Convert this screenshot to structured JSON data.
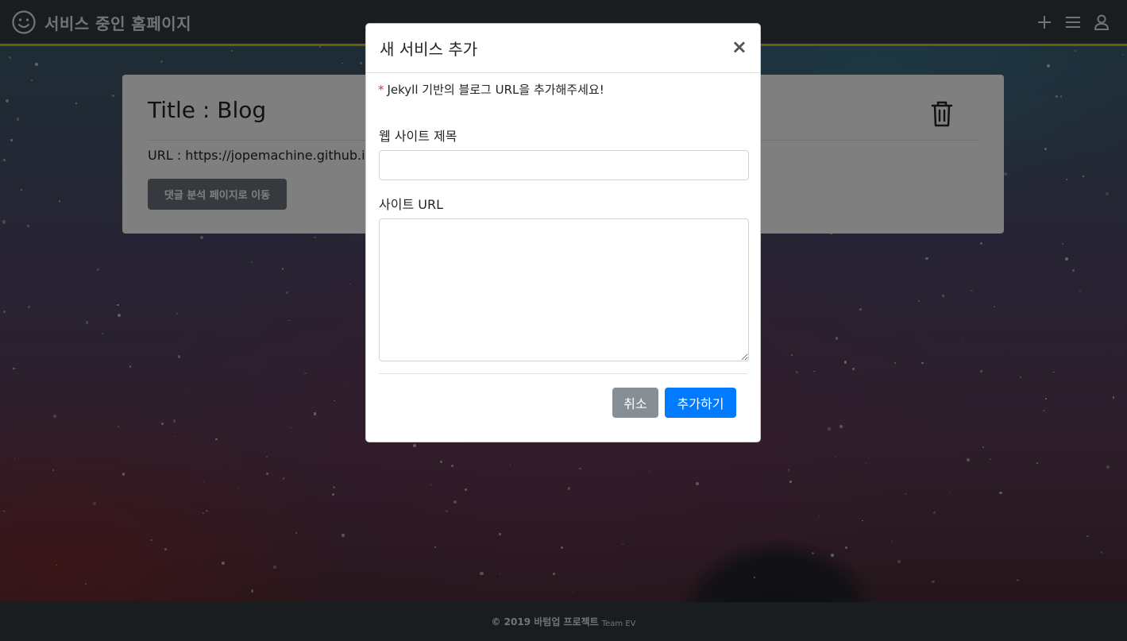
{
  "header": {
    "title": "서비스 중인 홈페이지",
    "icons": [
      "smiley-icon",
      "plus-icon",
      "menu-icon",
      "user-icon"
    ]
  },
  "card": {
    "title": "Title : Blog",
    "url": "URL : https://jopemachine.github.io",
    "button_label": "댓글 분석 페이지로 이동",
    "delete_icon": "trash-icon"
  },
  "modal": {
    "title": "새 서비스 추가",
    "close_label": "×",
    "notice_marker": "*",
    "notice": "Jekyll 기반의 블로그 URL을 추가해주세요!",
    "site_title_label": "웹 사이트 제목",
    "site_title_value": "",
    "site_url_label": "사이트 URL",
    "site_url_value": "",
    "cancel_label": "취소",
    "add_label": "추가하기"
  },
  "footer": {
    "text": "© 2019 바텀업 프로젝트",
    "team": "Team EV"
  },
  "colors": {
    "header_bg": "#343a40",
    "header_accent": "#c7c220",
    "primary": "#007bff",
    "secondary": "#868e96",
    "required": "#dc3545"
  }
}
